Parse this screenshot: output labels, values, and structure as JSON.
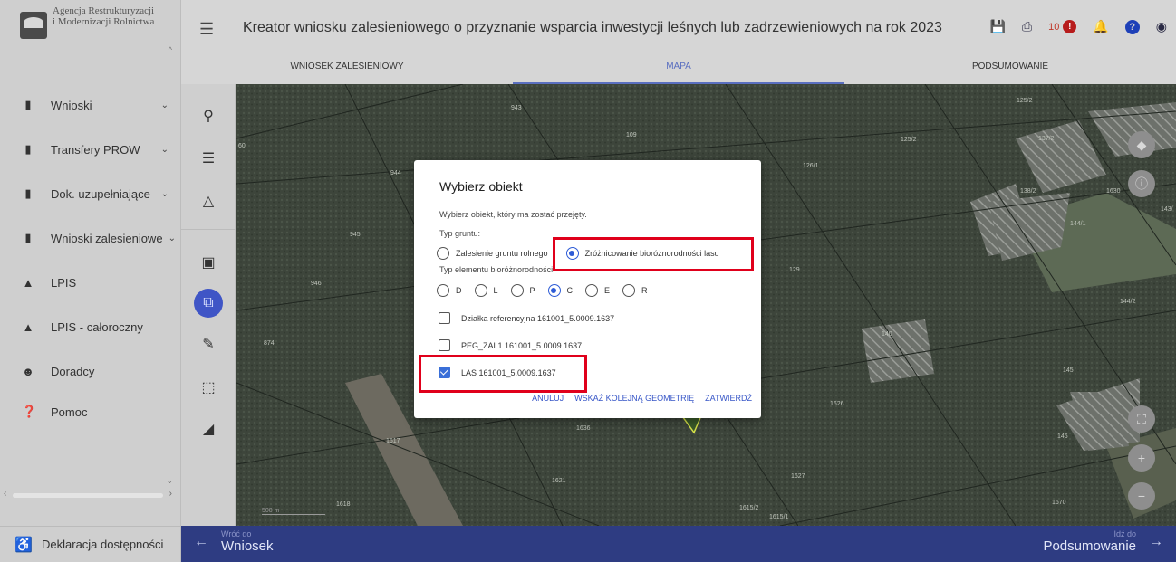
{
  "sidebar": {
    "logo_line1": "Agencja Restrukturyzacji",
    "logo_line2": "i Modernizacji Rolnictwa",
    "items": [
      {
        "label": "Wnioski",
        "icon": "clipboard-icon",
        "chevron": true
      },
      {
        "label": "Transfery PROW",
        "icon": "clipboard-icon",
        "chevron": true
      },
      {
        "label": "Dok. uzupełniające",
        "icon": "clipboard-icon",
        "chevron": true
      },
      {
        "label": "Wnioski zalesieniowe",
        "icon": "clipboard-icon",
        "chevron": true
      },
      {
        "label": "LPIS",
        "icon": "landscape-icon",
        "chevron": false
      },
      {
        "label": "LPIS - całoroczny",
        "icon": "landscape-icon",
        "chevron": false
      },
      {
        "label": "Doradcy",
        "icon": "person-icon",
        "chevron": false
      },
      {
        "label": "Pomoc",
        "icon": "help-icon",
        "chevron": false
      }
    ],
    "declaration": "Deklaracja dostępności"
  },
  "header": {
    "title": "Kreator wniosku zalesieniowego o przyznanie wsparcia inwestycji leśnych lub zadrzewieniowych na rok 2023",
    "notification_count": "10",
    "tabs": [
      {
        "label": "WNIOSEK ZALESIENIOWY",
        "active": false
      },
      {
        "label": "MAPA",
        "active": true
      },
      {
        "label": "PODSUMOWANIE",
        "active": false
      }
    ]
  },
  "map": {
    "parcel_labels": [
      "943",
      "109",
      "125/2",
      "125/2",
      "137/2",
      "944",
      "126/1",
      "138/2",
      "143/",
      "144/1",
      "945",
      "129",
      "946",
      "144/2",
      "874",
      "140",
      "145",
      "1626",
      "1636",
      "1617",
      "146",
      "1621",
      "1627",
      "1618",
      "1670",
      "1615/2",
      "1615/1",
      "60",
      "1630"
    ],
    "scale_text": "500 m"
  },
  "modal": {
    "title": "Wybierz obiekt",
    "description": "Wybierz obiekt, który ma zostać przejęty.",
    "ground_type_label": "Typ gruntu:",
    "ground_options": [
      {
        "label": "Zalesienie gruntu rolnego",
        "checked": false
      },
      {
        "label": "Zróżnicowanie bioróżnorodności lasu",
        "checked": true
      }
    ],
    "biodiversity_label": "Typ elementu bioróżnorodności:",
    "biodiversity_options": [
      {
        "label": "D",
        "checked": false
      },
      {
        "label": "L",
        "checked": false
      },
      {
        "label": "P",
        "checked": false
      },
      {
        "label": "C",
        "checked": true
      },
      {
        "label": "E",
        "checked": false
      },
      {
        "label": "R",
        "checked": false
      }
    ],
    "objects": [
      {
        "label": "Działka referencyjna 161001_5.0009.1637",
        "checked": false
      },
      {
        "label": "PEG_ZAL1 161001_5.0009.1637",
        "checked": false
      },
      {
        "label": "LAS 161001_5.0009.1637",
        "checked": true
      }
    ],
    "actions": {
      "cancel": "ANULUJ",
      "next_geometry": "WSKAŻ KOLEJNĄ GEOMETRIĘ",
      "confirm": "ZATWIERDŹ"
    }
  },
  "bottombar": {
    "back_small": "Wróć do",
    "back_big": "Wniosek",
    "next_small": "Idź do",
    "next_big": "Podsumowanie"
  },
  "colors": {
    "accent": "#3f55c6",
    "highlight": "#e0001b",
    "bottombar": "#2e3c82",
    "notification": "#b71c1c"
  }
}
